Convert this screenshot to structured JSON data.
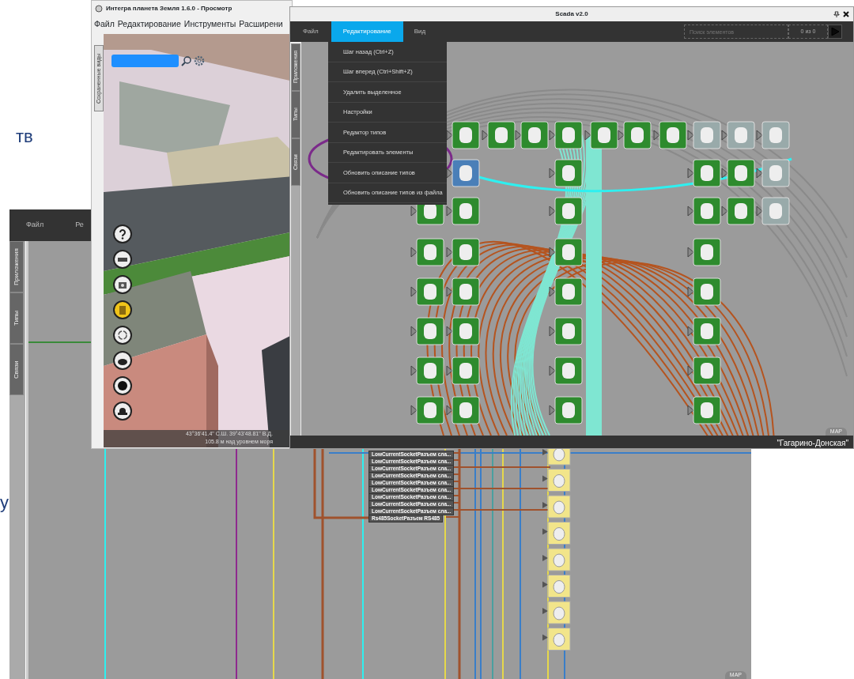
{
  "slide_fragments": [
    "тв",
    "у"
  ],
  "back_window": {
    "menu": [
      "Файл",
      "Ре"
    ],
    "side_tabs": [
      "Приложения",
      "Типы",
      "Связи"
    ],
    "socket_labels": [
      "LowCurrentSocketРазъем сла...",
      "LowCurrentSocketРазъем сла...",
      "LowCurrentSocketРазъем сла...",
      "LowCurrentSocketРазъем сла...",
      "LowCurrentSocketРазъем сла...",
      "LowCurrentSocketРазъем сла...",
      "LowCurrentSocketРазъем сла...",
      "LowCurrentSocketРазъем сла...",
      "LowCurrentSocketРазъем сла...",
      "Rs485SocketРазъем RS485"
    ],
    "map_label": "MAP"
  },
  "viewer_window": {
    "title": "Интегра планета Земля 1.6.0 - Просмотр",
    "menu": [
      "Файл",
      "Редактирование",
      "Инструменты",
      "Расширени"
    ],
    "side_tab": "Сохраненные виды",
    "tools": [
      {
        "selected": false
      },
      {
        "selected": false
      },
      {
        "selected": false
      },
      {
        "selected": true
      },
      {
        "selected": false
      },
      {
        "selected": false
      },
      {
        "selected": false
      },
      {
        "selected": false
      }
    ],
    "coordinates": "43°36'41.4\" С.Ш. 39°43'48.81\" В.Д.",
    "altitude": "105.8 м над уровнем моря"
  },
  "scada_window": {
    "title": "Scada v2.0",
    "menu": [
      {
        "label": "Файл",
        "selected": false
      },
      {
        "label": "Редактирование",
        "selected": true
      },
      {
        "label": "Вид",
        "selected": false
      }
    ],
    "search": {
      "placeholder": "Поиск элементов"
    },
    "match_count": "0 из 0",
    "side_tabs": [
      "Приложения",
      "Типы",
      "Связи"
    ],
    "dropdown": [
      "Шаг назад (Ctrl+Z)",
      "Шаг вперед (Ctrl+Shift+Z)",
      "Удалить выделенное",
      "Настройки",
      "Редактор типов",
      "Редактировать элементы",
      "Обновить описание типов",
      "Обновить описание типов из файла"
    ],
    "map_label": "MAP",
    "status": "\"Гагарино-Донская\""
  }
}
